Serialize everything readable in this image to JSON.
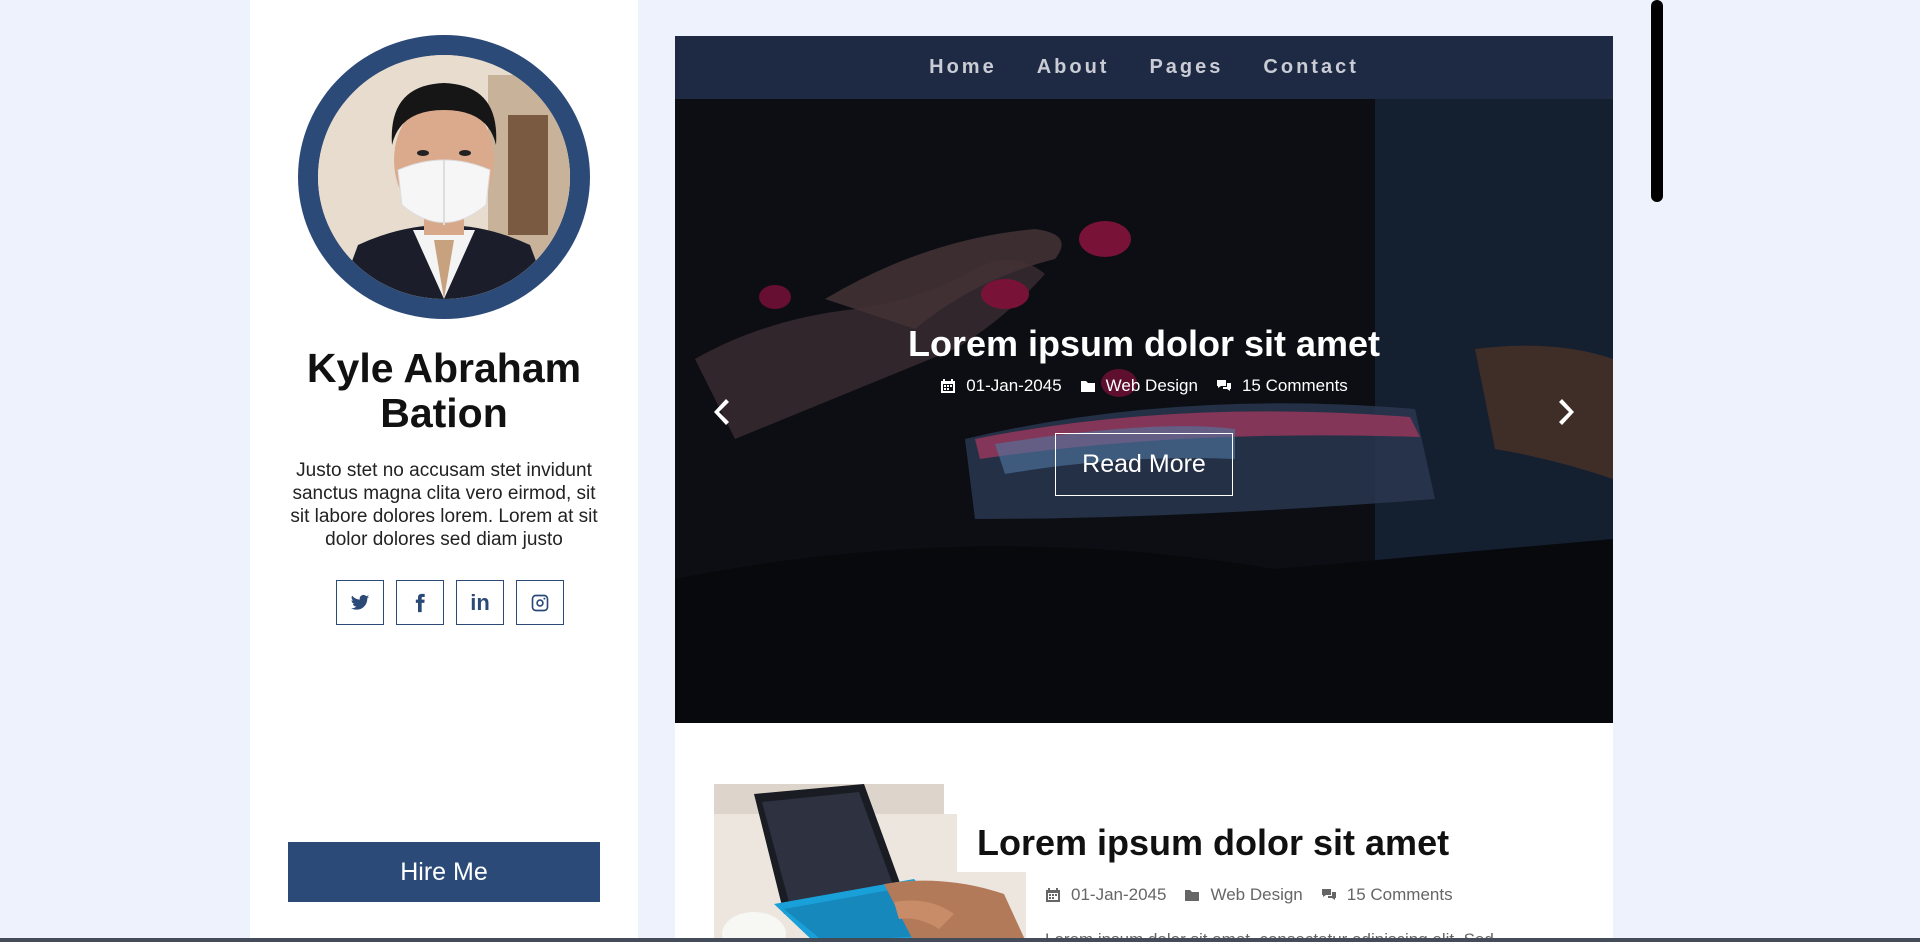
{
  "profile": {
    "name": "Kyle Abraham Bation",
    "bio": "Justo stet no accusam stet invidunt sanctus magna clita vero eirmod, sit sit labore dolores lorem. Lorem at sit dolor dolores sed diam justo",
    "socials": [
      "twitter-icon",
      "facebook-icon",
      "linkedin-icon",
      "instagram-icon"
    ],
    "linkedin_text": "in",
    "hire_label": "Hire Me"
  },
  "nav": {
    "items": [
      "Home",
      "About",
      "Pages",
      "Contact"
    ]
  },
  "hero": {
    "title": "Lorem ipsum dolor sit amet",
    "date": "01-Jan-2045",
    "category": "Web Design",
    "comments": "15 Comments",
    "button": "Read More"
  },
  "post": {
    "title": "Lorem ipsum dolor sit amet",
    "date": "01-Jan-2045",
    "category": "Web Design",
    "comments": "15 Comments",
    "excerpt": "Lorem ipsum dolor sit amet, consectetur adipiscing elit. Sed"
  },
  "colors": {
    "accent": "#2c4a78",
    "nav_bg": "#1e2a44",
    "page_bg": "#eef2fc"
  }
}
